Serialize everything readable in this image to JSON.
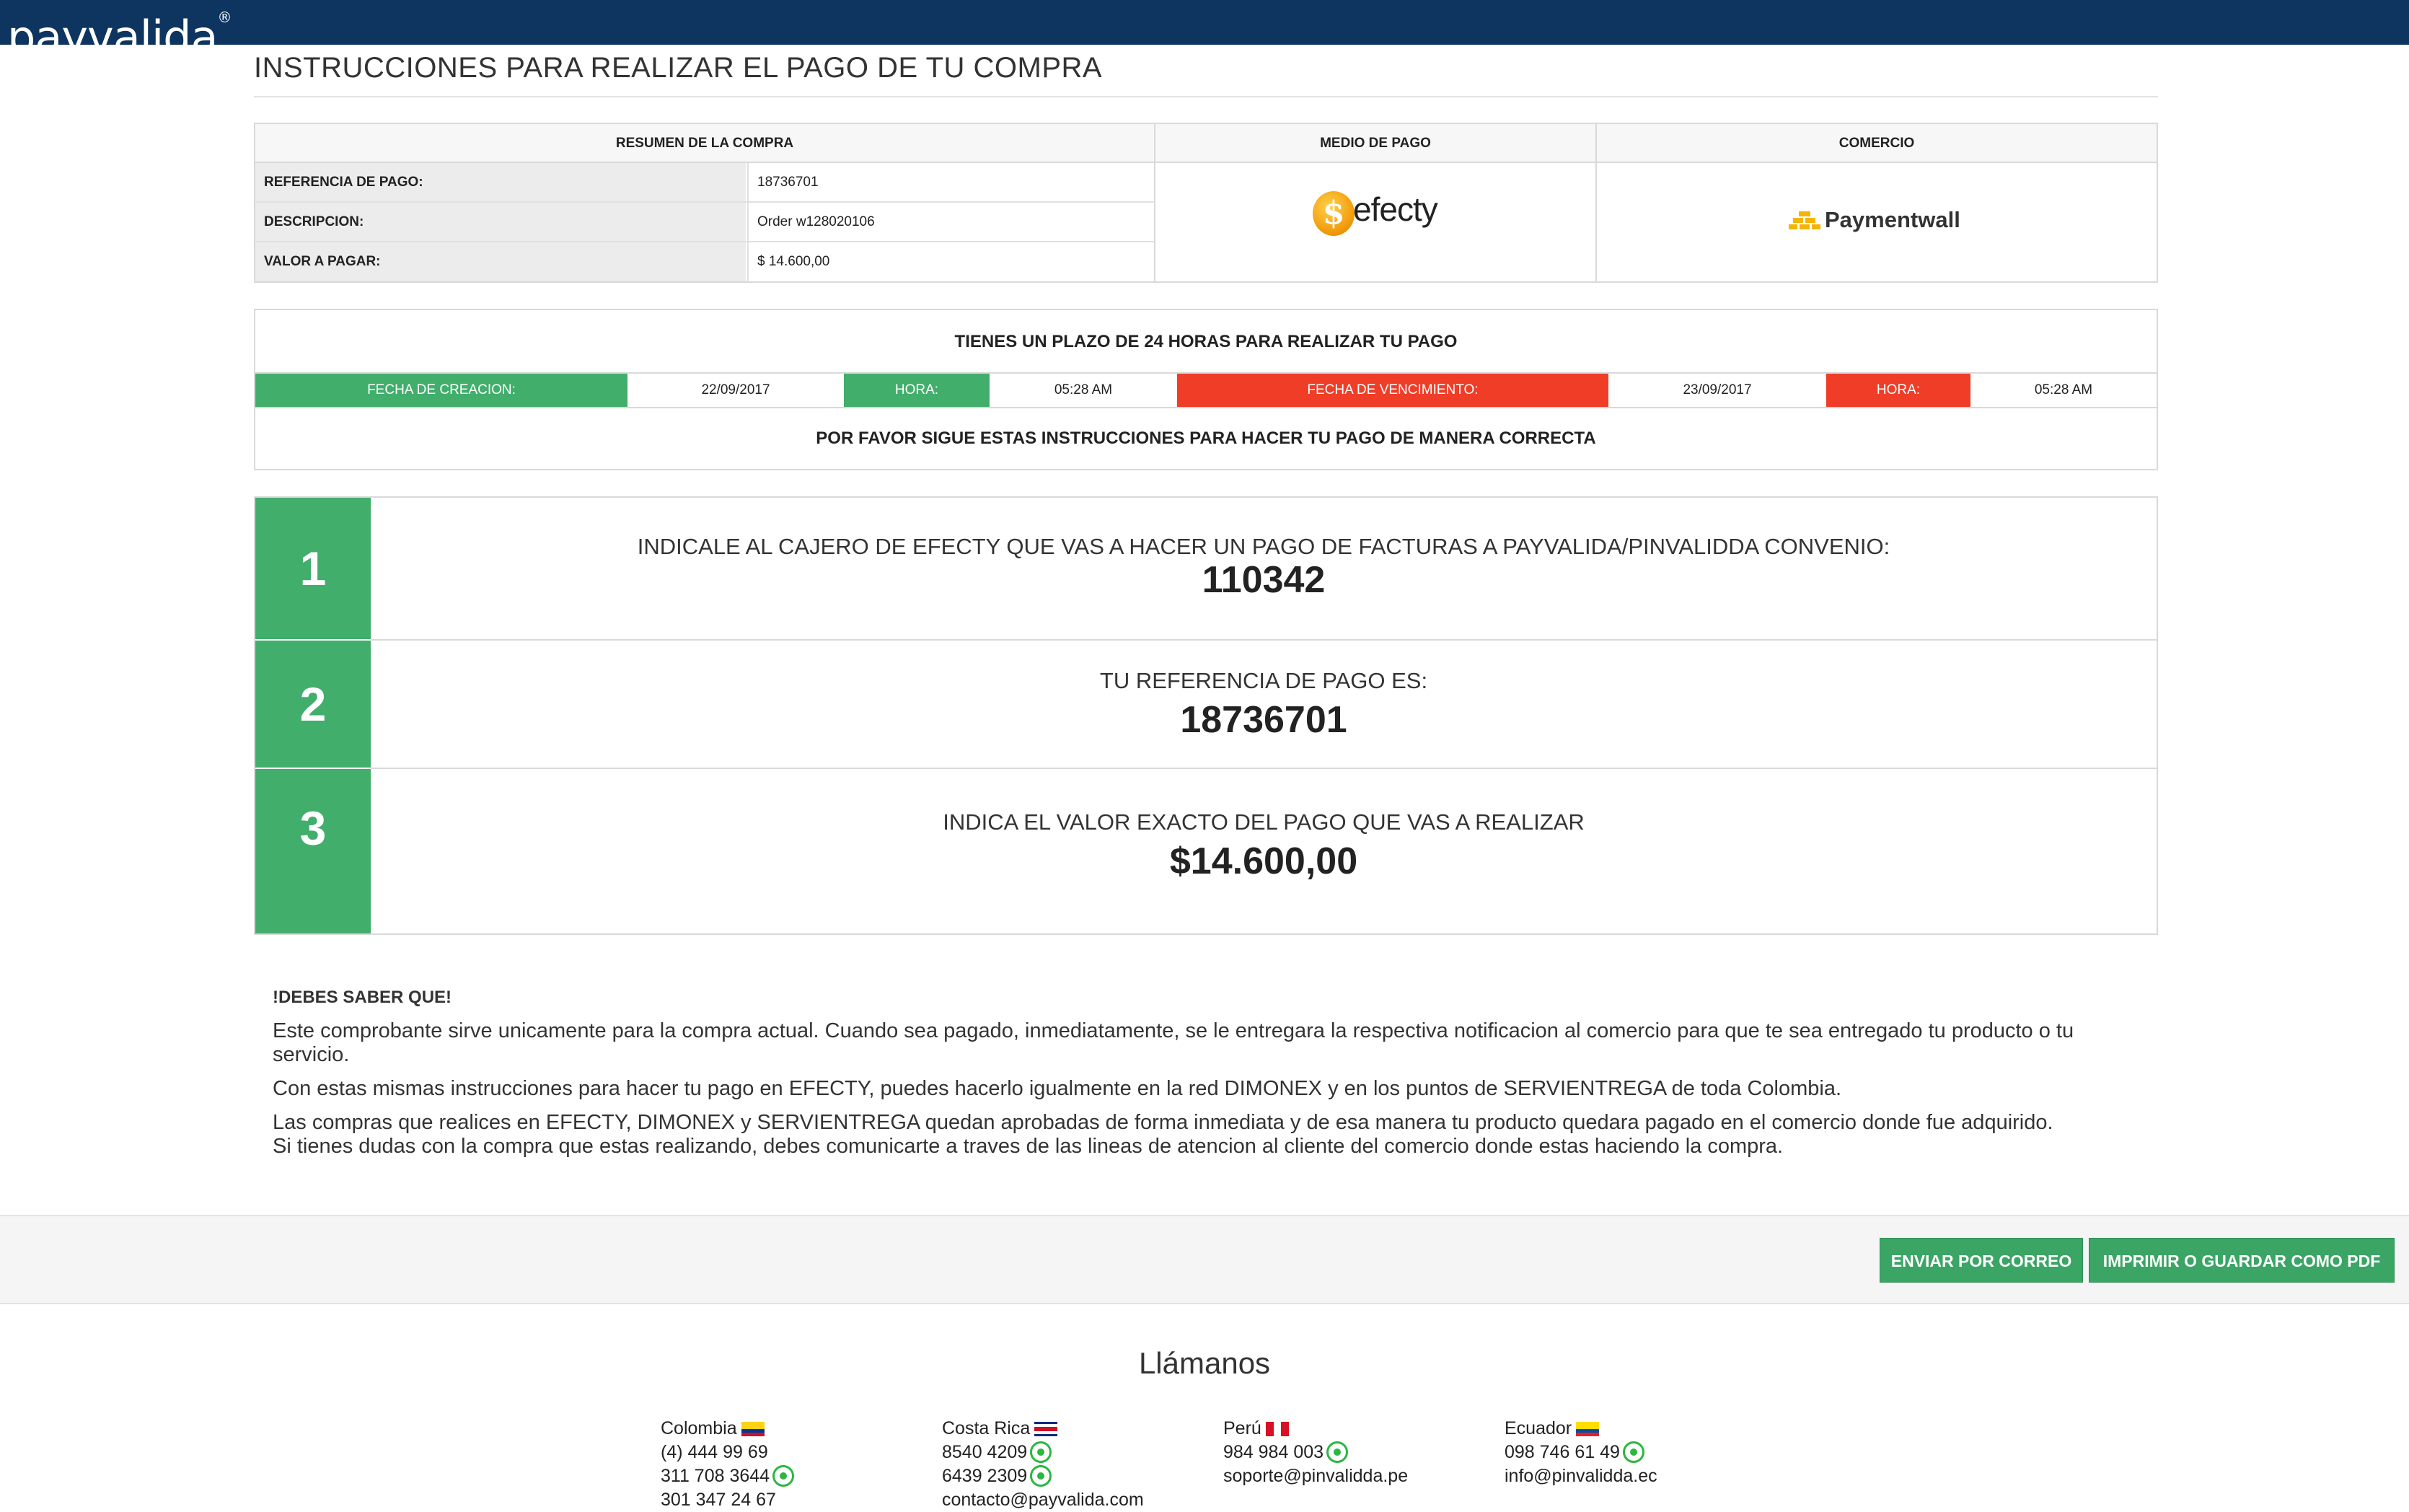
{
  "brand": {
    "logo": "payvalida",
    "reg": "®"
  },
  "page_title": "INSTRUCCIONES PARA REALIZAR EL PAGO DE TU COMPRA",
  "summary": {
    "headers": {
      "resumen": "RESUMEN DE LA COMPRA",
      "medio": "MEDIO DE PAGO",
      "comercio": "COMERCIO"
    },
    "rows": [
      {
        "label": "REFERENCIA DE PAGO:",
        "value": "18736701"
      },
      {
        "label": "DESCRIPCION:",
        "value": "Order w128020106"
      },
      {
        "label": "VALOR A PAGAR:",
        "value": "$ 14.600,00"
      }
    ],
    "payment_method_logo": "efecty",
    "merchant_logo": "Paymentwall"
  },
  "deadline": {
    "headline": "TIENES UN PLAZO DE 24 HORAS PARA REALIZAR TU PAGO",
    "creation_label": "FECHA DE CREACION:",
    "creation_date": "22/09/2017",
    "hour_label": "HORA:",
    "creation_time": "05:28 AM",
    "expiry_label": "FECHA DE VENCIMIENTO:",
    "expiry_date": "23/09/2017",
    "expiry_time": "05:28 AM",
    "follow": "POR FAVOR SIGUE ESTAS INSTRUCCIONES PARA HACER TU PAGO DE MANERA CORRECTA"
  },
  "steps": [
    {
      "num": "1",
      "text": "INDICALE AL CAJERO DE EFECTY QUE VAS A HACER UN PAGO DE FACTURAS A PAYVALIDA/PINVALIDDA CONVENIO:",
      "value": "110342"
    },
    {
      "num": "2",
      "text": "TU REFERENCIA DE PAGO ES:",
      "value": "18736701"
    },
    {
      "num": "3",
      "text": "INDICA EL VALOR EXACTO DEL PAGO QUE VAS A REALIZAR",
      "value": "$14.600,00"
    }
  ],
  "info": {
    "heading": "!DEBES SABER QUE!",
    "p1": "Este comprobante sirve unicamente para la compra actual. Cuando sea pagado, inmediatamente, se le entregara la respectiva notificacion al comercio para que te sea entregado tu producto o tu servicio.",
    "p2": "Con estas mismas instrucciones para hacer tu pago en EFECTY, puedes hacerlo igualmente en la red DIMONEX y en los puntos de SERVIENTREGA de toda Colombia.",
    "p3a": "Las compras que realices en EFECTY, DIMONEX y SERVIENTREGA quedan aprobadas de forma inmediata y de esa manera tu producto quedara pagado en el comercio donde fue adquirido.",
    "p3b": "Si tienes dudas con la compra que estas realizando, debes comunicarte a traves de las lineas de atencion al cliente del comercio donde estas haciendo la compra."
  },
  "actions": {
    "email": "ENVIAR POR CORREO",
    "print": "IMPRIMIR O GUARDAR COMO PDF"
  },
  "contact": {
    "title": "Llámanos",
    "countries": [
      {
        "name": "Colombia",
        "lines": [
          "(4) 444 99 69",
          "311 708 3644",
          "301 347 24 67"
        ]
      },
      {
        "name": "Costa Rica",
        "lines": [
          "8540 4209",
          "6439 2309",
          "contacto@payvalida.com"
        ]
      },
      {
        "name": "Perú",
        "lines": [
          "984 984 003",
          "soporte@pinvalidda.pe"
        ]
      },
      {
        "name": "Ecuador",
        "lines": [
          "098 746 61 49",
          "info@pinvalidda.ec"
        ]
      }
    ]
  },
  "colors": {
    "topbar": "#0d3560",
    "green": "#42ae6c",
    "red": "#ef3d28",
    "button": "#3aa565"
  }
}
